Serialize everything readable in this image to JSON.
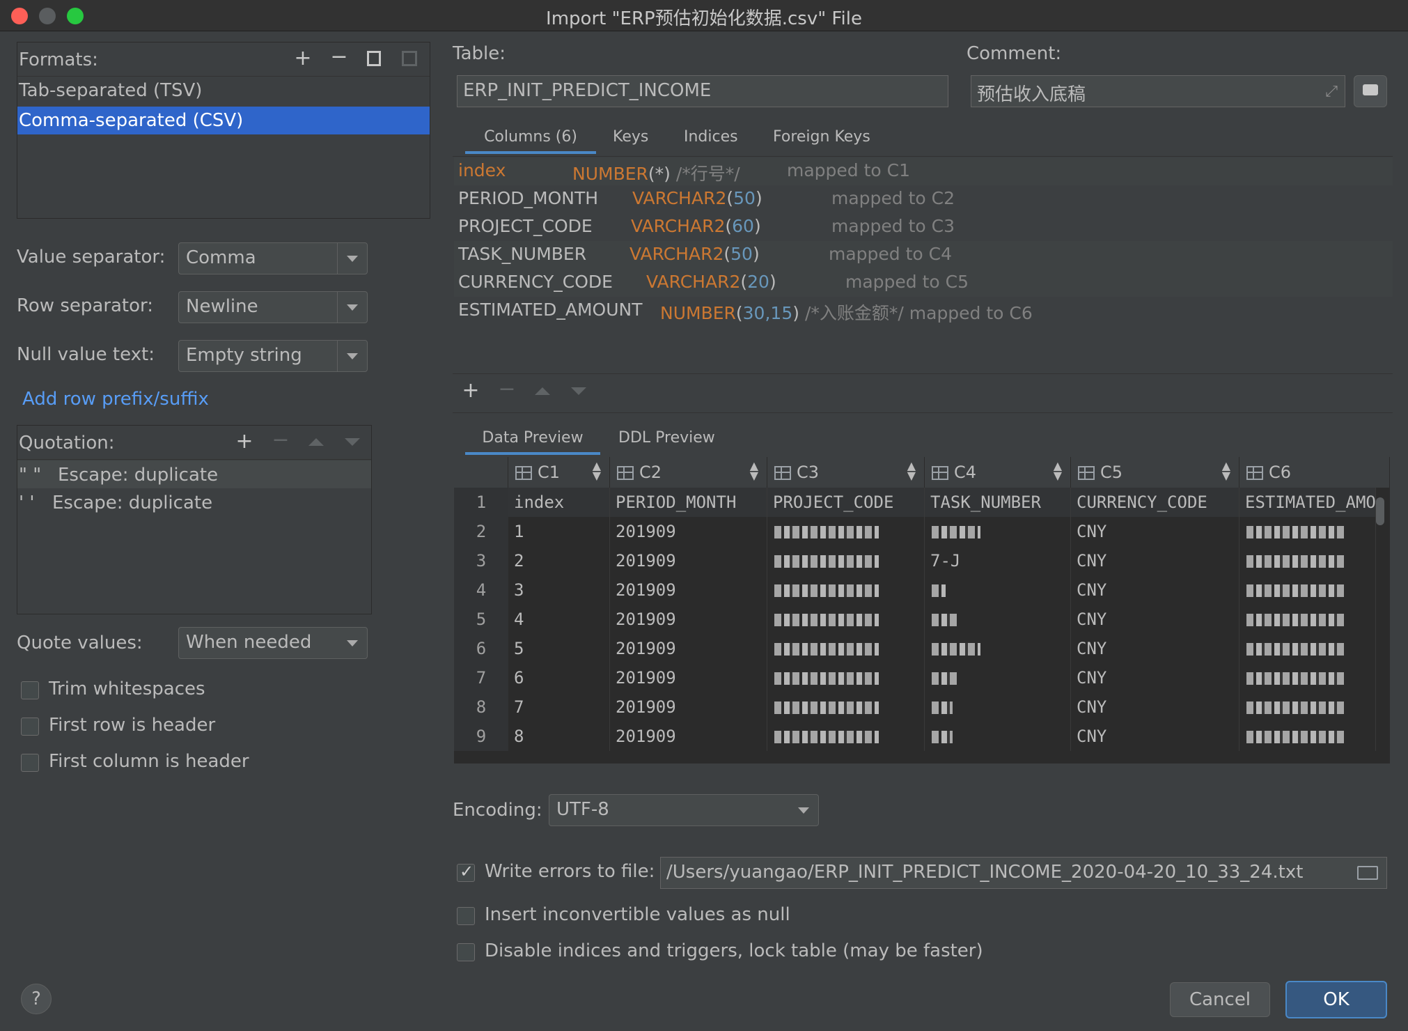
{
  "window": {
    "title": "Import \"ERP预估初始化数据.csv\" File"
  },
  "left": {
    "formats_label": "Formats:",
    "formats": [
      "Tab-separated (TSV)",
      "Comma-separated (CSV)"
    ],
    "value_separator_label": "Value separator:",
    "value_separator": "Comma",
    "row_separator_label": "Row separator:",
    "row_separator": "Newline",
    "null_text_label": "Null value text:",
    "null_text": "Empty string",
    "add_prefix_link": "Add row prefix/suffix",
    "quotation_label": "Quotation:",
    "quotations": [
      {
        "quote": "\"  \"",
        "escape": "Escape: duplicate"
      },
      {
        "quote": "'  '",
        "escape": "Escape: duplicate"
      }
    ],
    "quote_values_label": "Quote values:",
    "quote_values": "When needed",
    "trim_label": "Trim whitespaces",
    "first_row_label": "First row is header",
    "first_col_label": "First column is header"
  },
  "table": {
    "table_label": "Table:",
    "table_name": "ERP_INIT_PREDICT_INCOME",
    "comment_label": "Comment:",
    "comment": "预估收入底稿"
  },
  "tabs": [
    "Columns (6)",
    "Keys",
    "Indices",
    "Foreign Keys"
  ],
  "columns": [
    {
      "name": "index",
      "type": "NUMBER",
      "open": "(",
      "args": "*",
      "close": ")",
      "comment": "/*行号*/",
      "mapped": "mapped to C1"
    },
    {
      "name": "PERIOD_MONTH",
      "type": "VARCHAR2",
      "open": "(",
      "args": "50",
      "close": ")",
      "comment": "",
      "mapped": "mapped to C2"
    },
    {
      "name": "PROJECT_CODE",
      "type": "VARCHAR2",
      "open": "(",
      "args": "60",
      "close": ")",
      "comment": "",
      "mapped": "mapped to C3"
    },
    {
      "name": "TASK_NUMBER",
      "type": "VARCHAR2",
      "open": "(",
      "args": "50",
      "close": ")",
      "comment": "",
      "mapped": "mapped to C4"
    },
    {
      "name": "CURRENCY_CODE",
      "type": "VARCHAR2",
      "open": "(",
      "args": "20",
      "close": ")",
      "comment": "",
      "mapped": "mapped to C5"
    },
    {
      "name": "ESTIMATED_AMOUNT",
      "type": "NUMBER",
      "open": "(",
      "args": "30,15",
      "close": ")",
      "comment": "/*入账金额*/",
      "mapped": "mapped to C6"
    }
  ],
  "preview_tabs": [
    "Data Preview",
    "DDL Preview"
  ],
  "grid": {
    "headers": [
      "C1",
      "C2",
      "C3",
      "C4",
      "C5",
      "C6"
    ],
    "rows": [
      {
        "n": "1",
        "c1": "index",
        "c2": "PERIOD_MONTH",
        "c3": "PROJECT_CODE",
        "c4": "TASK_NUMBER",
        "c5": "CURRENCY_CODE",
        "c6": "ESTIMATED_AMOUNT"
      },
      {
        "n": "2",
        "c1": "1",
        "c2": "201909",
        "c3": "",
        "c4": "",
        "c5": "CNY",
        "c6": ""
      },
      {
        "n": "3",
        "c1": "2",
        "c2": "201909",
        "c3": "",
        "c4": "7-J",
        "c5": "CNY",
        "c6": ""
      },
      {
        "n": "4",
        "c1": "3",
        "c2": "201909",
        "c3": "",
        "c4": "",
        "c5": "CNY",
        "c6": ""
      },
      {
        "n": "5",
        "c1": "4",
        "c2": "201909",
        "c3": "",
        "c4": "",
        "c5": "CNY",
        "c6": ""
      },
      {
        "n": "6",
        "c1": "5",
        "c2": "201909",
        "c3": "",
        "c4": "",
        "c5": "CNY",
        "c6": ""
      },
      {
        "n": "7",
        "c1": "6",
        "c2": "201909",
        "c3": "",
        "c4": "",
        "c5": "CNY",
        "c6": ""
      },
      {
        "n": "8",
        "c1": "7",
        "c2": "201909",
        "c3": "",
        "c4": "",
        "c5": "CNY",
        "c6": ""
      },
      {
        "n": "9",
        "c1": "8",
        "c2": "201909",
        "c3": "",
        "c4": "",
        "c5": "CNY",
        "c6": ""
      }
    ]
  },
  "encoding": {
    "label": "Encoding:",
    "value": "UTF-8"
  },
  "options": {
    "write_errors_label": "Write errors to file:",
    "errors_path": "/Users/yuangao/ERP_INIT_PREDICT_INCOME_2020-04-20_10_33_24.txt",
    "insert_null_label": "Insert inconvertible values as null",
    "disable_indices_label": "Disable indices and triggers, lock table (may be faster)"
  },
  "buttons": {
    "help": "?",
    "cancel": "Cancel",
    "ok": "OK"
  },
  "colors": {
    "selection": "#2f65ca",
    "keyword": "#cc7832",
    "number": "#6897bb",
    "link": "#589df6"
  }
}
